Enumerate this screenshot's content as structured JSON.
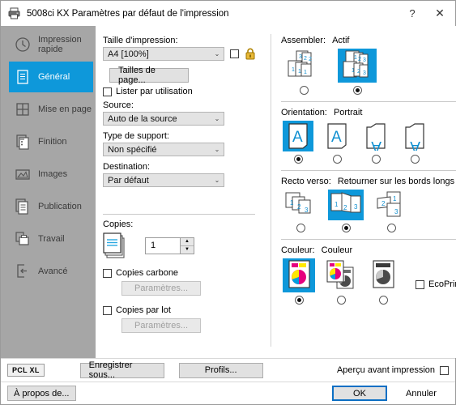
{
  "window": {
    "title": "5008ci KX Paramètres par défaut de l'impression",
    "icon": "printer-icon",
    "help_label": "?",
    "close_label": "✕"
  },
  "sidebar": {
    "items": [
      {
        "label": "Impression rapide",
        "icon": "clock-icon",
        "active": false
      },
      {
        "label": "Général",
        "icon": "document-icon",
        "active": true
      },
      {
        "label": "Mise en page",
        "icon": "grid-icon",
        "active": false
      },
      {
        "label": "Finition",
        "icon": "staple-icon",
        "active": false
      },
      {
        "label": "Images",
        "icon": "picture-icon",
        "active": false
      },
      {
        "label": "Publication",
        "icon": "booklet-icon",
        "active": false
      },
      {
        "label": "Travail",
        "icon": "job-icon",
        "active": false
      },
      {
        "label": "Avancé",
        "icon": "advanced-icon",
        "active": false
      }
    ]
  },
  "left_panel": {
    "print_size": {
      "label": "Taille d'impression:",
      "value": "A4  [100%]",
      "lock_checkbox_checked": false,
      "lock_icon": "padlock-icon"
    },
    "page_sizes_button": "Tailles de page...",
    "list_by_use": {
      "label": "Lister par utilisation",
      "checked": false
    },
    "source": {
      "label": "Source:",
      "value": "Auto de la source"
    },
    "media_type": {
      "label": "Type de support:",
      "value": "Non spécifié"
    },
    "destination": {
      "label": "Destination:",
      "value": "Par défaut"
    },
    "copies": {
      "label": "Copies:",
      "value": "1",
      "carbon": {
        "label": "Copies carbone",
        "checked": false,
        "settings_button": "Paramètres..."
      },
      "batch": {
        "label": "Copies par lot",
        "checked": false,
        "settings_button": "Paramètres..."
      }
    }
  },
  "right_panel": {
    "collate": {
      "title": "Assembler:",
      "value": "Actif",
      "selected_index": 1,
      "options": [
        "non-collated",
        "collated"
      ]
    },
    "orientation": {
      "title": "Orientation:",
      "value": "Portrait",
      "selected_index": 0,
      "options": [
        "portrait",
        "portrait-rotated",
        "landscape",
        "landscape-rotated"
      ]
    },
    "duplex": {
      "title": "Recto verso:",
      "value": "Retourner sur les bords longs",
      "selected_index": 1,
      "options": [
        "simplex",
        "flip-long-edge",
        "flip-short-edge"
      ]
    },
    "color": {
      "title": "Couleur:",
      "value": "Couleur",
      "selected_index": 0,
      "options": [
        "full-color",
        "color-and-mono",
        "monochrome"
      ],
      "ecoprint": {
        "label": "EcoPrint",
        "checked": false
      }
    }
  },
  "footer": {
    "pdl_badge": "PCL XL",
    "save_as_button": "Enregistrer sous...",
    "profiles_button": "Profils...",
    "print_preview": {
      "label": "Aperçu avant impression",
      "checked": false
    },
    "about_button": "À propos de...",
    "ok_button": "OK",
    "cancel_button": "Annuler"
  },
  "colors": {
    "accent": "#0e98da",
    "sidebar": "#a6a6a6",
    "focus_border": "#0b6fc4",
    "lock_gold": "#d8a418"
  }
}
